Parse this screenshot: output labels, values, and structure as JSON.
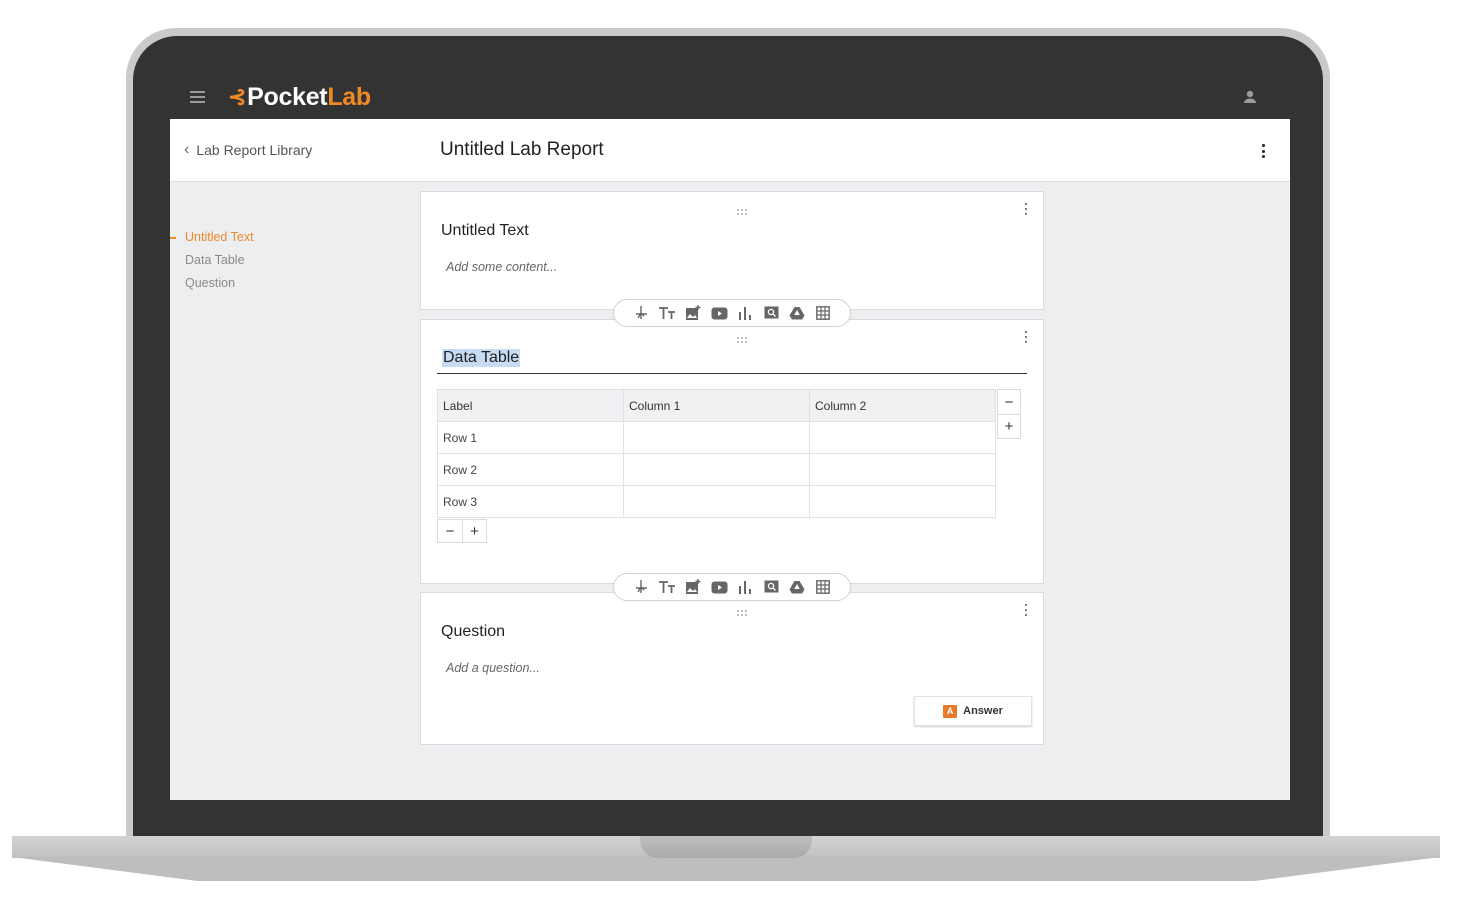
{
  "app": {
    "logo_part1": "Pocket",
    "logo_part2": "Lab",
    "brand_color": "#f08a24",
    "menu_icon": "hamburger-icon",
    "user_icon": "user-icon"
  },
  "header": {
    "back_label": "Lab Report Library",
    "title": "Untitled Lab Report"
  },
  "outline": {
    "items": [
      {
        "label": "Untitled Text",
        "active": true
      },
      {
        "label": "Data Table",
        "active": false
      },
      {
        "label": "Question",
        "active": false
      }
    ]
  },
  "text_block": {
    "title": "Untitled Text",
    "placeholder": "Add some content..."
  },
  "toolbar": {
    "icons": [
      "graph-icon",
      "text-icon",
      "add-image-icon",
      "video-icon",
      "bar-chart-icon",
      "zoom-icon",
      "drive-icon",
      "table-icon"
    ]
  },
  "data_table": {
    "title": "Data Table",
    "headers": [
      "Label",
      "Column 1",
      "Column 2"
    ],
    "rows": [
      {
        "label": "Row 1",
        "cells": [
          "",
          ""
        ]
      },
      {
        "label": "Row 2",
        "cells": [
          "",
          ""
        ]
      },
      {
        "label": "Row 3",
        "cells": [
          "",
          ""
        ]
      }
    ],
    "minus": "−",
    "plus": "+"
  },
  "question_block": {
    "title": "Question",
    "placeholder": "Add a question...",
    "answer_label": "Answer",
    "answer_icon_letter": "A"
  }
}
